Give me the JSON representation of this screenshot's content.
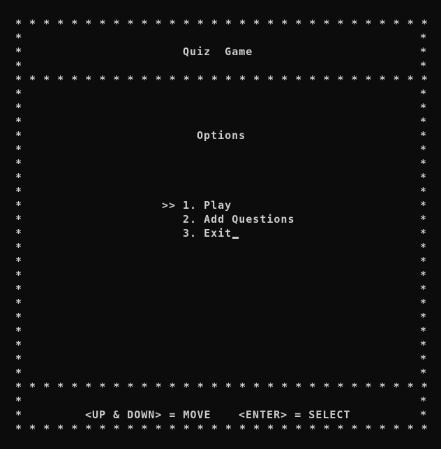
{
  "game": {
    "title": "Quiz  Game",
    "menu_heading": "Options",
    "selector": ">>",
    "menu_items": [
      {
        "label": "1. Play"
      },
      {
        "label": "2. Add Questions"
      },
      {
        "label": "3. Exit"
      }
    ],
    "selected_index": 0,
    "controls": {
      "move": "<UP & DOWN> = MOVE",
      "select": "<ENTER> = SELECT"
    },
    "border_char": "*"
  },
  "colors": {
    "background": "#0c0c0c",
    "foreground": "#cccccc"
  }
}
